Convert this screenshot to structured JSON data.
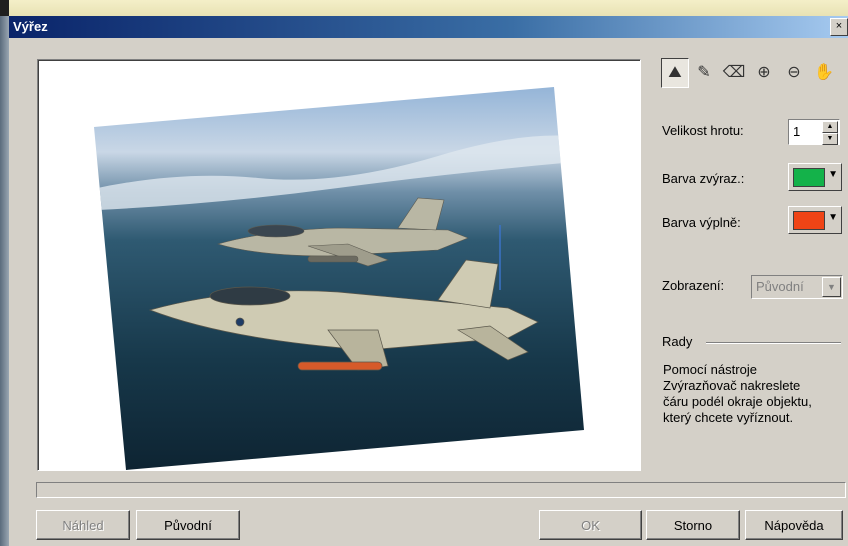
{
  "window": {
    "title": "Výřez",
    "close_label": "×"
  },
  "toolbar": {
    "tools": [
      {
        "name": "selection-tool",
        "glyph": "⛰",
        "active": true
      },
      {
        "name": "highlighter-tool",
        "glyph": "✎"
      },
      {
        "name": "eraser-tool",
        "glyph": "⌫"
      },
      {
        "name": "zoom-in-tool",
        "glyph": "⊕"
      },
      {
        "name": "zoom-out-tool",
        "glyph": "⊖"
      },
      {
        "name": "hand-tool",
        "glyph": "✋"
      }
    ]
  },
  "settings": {
    "brush_size_label": "Velikost hrotu:",
    "brush_size_value": "1",
    "highlight_color_label": "Barva zvýraz.:",
    "highlight_color": "#14b24a",
    "fill_color_label": "Barva výplně:",
    "fill_color": "#ef4416",
    "display_label": "Zobrazení:",
    "display_value": "Původní"
  },
  "tips": {
    "heading": "Rady",
    "lines": [
      "Pomocí nástroje",
      "Zvýrazňovač nakreslete",
      "čáru podél okraje objektu,",
      "který chcete vyříznout."
    ]
  },
  "buttons": {
    "preview": "Náhled",
    "original": "Původní",
    "ok": "OK",
    "cancel": "Storno",
    "help": "Nápověda"
  }
}
